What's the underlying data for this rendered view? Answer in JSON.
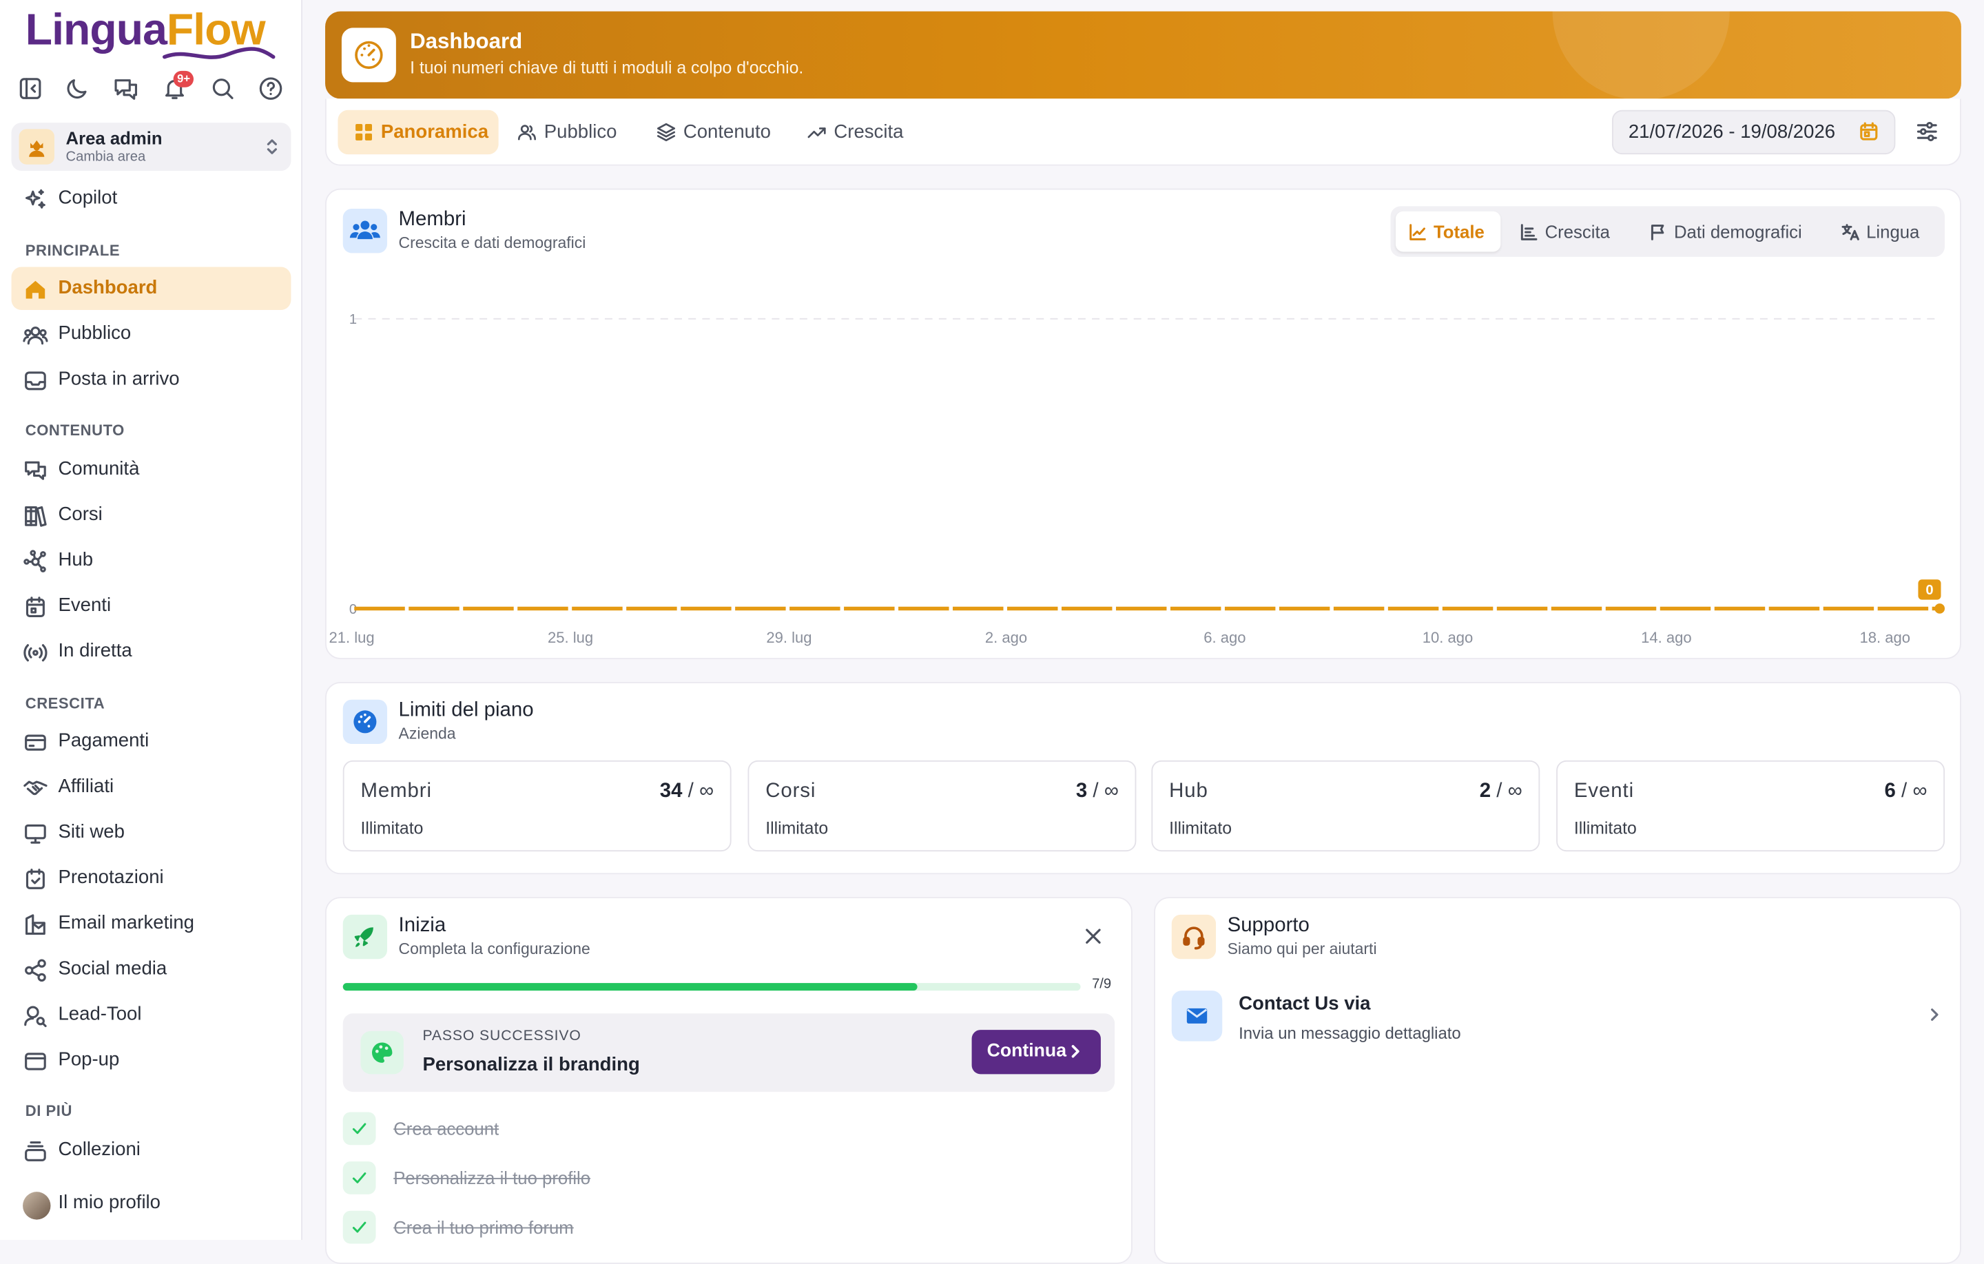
{
  "brand": {
    "part1": "Lingua",
    "part2": "Flow"
  },
  "topbar": {
    "notifications_badge": "9+",
    "icons": [
      "collapse-sidebar-icon",
      "moon-icon",
      "chat-icon",
      "bell-icon",
      "search-icon",
      "help-icon"
    ]
  },
  "area": {
    "title": "Area admin",
    "subtitle": "Cambia area"
  },
  "copilot": "Copilot",
  "sections": {
    "principale": "PRINCIPALE",
    "contenuto": "CONTENUTO",
    "crescita": "CRESCITA",
    "dipiu": "DI PIÙ"
  },
  "nav": {
    "principale": [
      {
        "label": "Dashboard",
        "active": true
      },
      {
        "label": "Pubblico"
      },
      {
        "label": "Posta in arrivo"
      }
    ],
    "contenuto": [
      {
        "label": "Comunità"
      },
      {
        "label": "Corsi"
      },
      {
        "label": "Hub"
      },
      {
        "label": "Eventi"
      },
      {
        "label": "In diretta"
      }
    ],
    "crescita": [
      {
        "label": "Pagamenti"
      },
      {
        "label": "Affiliati"
      },
      {
        "label": "Siti web"
      },
      {
        "label": "Prenotazioni"
      },
      {
        "label": "Email marketing"
      },
      {
        "label": "Social media"
      },
      {
        "label": "Lead-Tool"
      },
      {
        "label": "Pop-up"
      }
    ],
    "dipiu": [
      {
        "label": "Collezioni"
      },
      {
        "label": "Il mio profilo"
      }
    ]
  },
  "hero": {
    "title": "Dashboard",
    "subtitle": "I tuoi numeri chiave di tutti i moduli a colpo d'occhio."
  },
  "tabs": [
    "Panoramica",
    "Pubblico",
    "Contenuto",
    "Crescita"
  ],
  "date_range": "21/07/2026 - 19/08/2026",
  "members": {
    "title": "Membri",
    "subtitle": "Crescita e dati demografici",
    "segments": [
      "Totale",
      "Crescita",
      "Dati demografici",
      "Lingua"
    ]
  },
  "chart_data": {
    "type": "line",
    "x": [
      "21. lug",
      "22. lug",
      "23. lug",
      "24. lug",
      "25. lug",
      "26. lug",
      "27. lug",
      "28. lug",
      "29. lug",
      "30. lug",
      "31. lug",
      "1. ago",
      "2. ago",
      "3. ago",
      "4. ago",
      "5. ago",
      "6. ago",
      "7. ago",
      "8. ago",
      "9. ago",
      "10. ago",
      "11. ago",
      "12. ago",
      "13. ago",
      "14. ago",
      "15. ago",
      "16. ago",
      "17. ago",
      "18. ago",
      "19. ago"
    ],
    "x_tick_labels": [
      "21. lug",
      "25. lug",
      "29. lug",
      "2. ago",
      "6. ago",
      "10. ago",
      "14. ago",
      "18. ago"
    ],
    "series": [
      {
        "values": [
          0,
          0,
          0,
          0,
          0,
          0,
          0,
          0,
          0,
          0,
          0,
          0,
          0,
          0,
          0,
          0,
          0,
          0,
          0,
          0,
          0,
          0,
          0,
          0,
          0,
          0,
          0,
          0,
          0,
          0
        ],
        "color": "#e59a12"
      }
    ],
    "y_ticks": [
      "0",
      "1"
    ],
    "ylim": [
      0,
      1
    ],
    "last_value_label": "0",
    "grid": true
  },
  "limits": {
    "title": "Limiti del piano",
    "subtitle": "Azienda",
    "items": [
      {
        "name": "Membri",
        "value": "34",
        "max": "/ ∞",
        "status": "Illimitato"
      },
      {
        "name": "Corsi",
        "value": "3",
        "max": "/ ∞",
        "status": "Illimitato"
      },
      {
        "name": "Hub",
        "value": "2",
        "max": "/ ∞",
        "status": "Illimitato"
      },
      {
        "name": "Eventi",
        "value": "6",
        "max": "/ ∞",
        "status": "Illimitato"
      }
    ]
  },
  "start": {
    "title": "Inizia",
    "subtitle": "Completa la configurazione",
    "progress_label": "7/9",
    "progress_fraction": 0.778,
    "next_kicker": "PASSO SUCCESSIVO",
    "next_title": "Personalizza il branding",
    "continue": "Continua",
    "done": [
      "Crea account",
      "Personalizza il tuo profilo",
      "Crea il tuo primo forum"
    ]
  },
  "support": {
    "title": "Supporto",
    "subtitle": "Siamo qui per aiutarti",
    "contact_title": "Contact Us via",
    "contact_subtitle": "Invia un messaggio dettagliato"
  }
}
